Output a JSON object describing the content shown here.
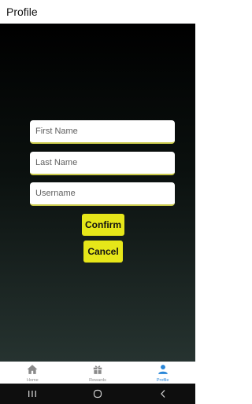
{
  "header": {
    "title": "Profile"
  },
  "form": {
    "first_name_placeholder": "First Name",
    "last_name_placeholder": "Last Name",
    "username_placeholder": "Username",
    "confirm_label": "Confirm",
    "cancel_label": "Cancel"
  },
  "tabs": [
    {
      "label": "Home",
      "icon": "home-icon"
    },
    {
      "label": "Rewards",
      "icon": "gift-icon"
    },
    {
      "label": "Profile",
      "icon": "person-icon",
      "active": true
    }
  ],
  "system_nav": {
    "icons": [
      "recents-icon",
      "home-circle-icon",
      "back-icon"
    ]
  },
  "colors": {
    "accent_button": "#e6e619",
    "active_tab": "#2a87d8",
    "inactive_tab": "#8a8a8a"
  }
}
